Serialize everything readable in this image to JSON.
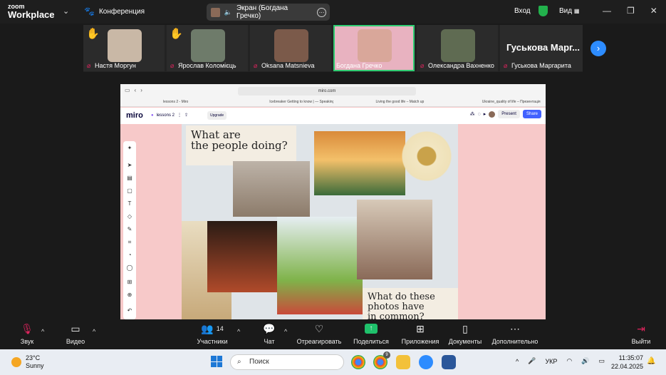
{
  "titlebar": {
    "logo_line1": "zoom",
    "logo_line2": "Workplace",
    "conference": "Конференция",
    "screen_label": "Экран (Богдана Гречко)",
    "login": "Вход",
    "view": "Вид"
  },
  "participants": [
    {
      "name": "Настя Моргун",
      "hand": true,
      "photo_color": "#c9b8a6"
    },
    {
      "name": "Ярослав Коломієць",
      "hand": true,
      "photo_color": "#6e7b6a"
    },
    {
      "name": "Oksana Matsnieva",
      "hand": false,
      "photo_color": "#7b5a4a"
    },
    {
      "name": "Богдана Гречко",
      "hand": false,
      "photo_color": "#d9a79a",
      "active": true
    },
    {
      "name": "Олександра Вахненко",
      "hand": false,
      "photo_color": "#5f6b52"
    },
    {
      "name": "Гуськова Маргарита",
      "hand": false,
      "big_label": "Гуськова  Марг..."
    }
  ],
  "browser": {
    "url": "miro.com",
    "tabs": [
      "lessons 2 - Miro",
      "Icebreaker Getting to know | — Speaking cards",
      "Living the good life – Match up",
      "Ukraine_quality of life – Презентація"
    ]
  },
  "miro": {
    "brand": "miro",
    "board_name": "lessons 2",
    "upgrade": "Upgrade",
    "present": "Present",
    "share": "Share"
  },
  "collage": {
    "title1_line1": "What are",
    "title1_line2": "the people doing?",
    "title2_line1": "What do these",
    "title2_line2": "photos have",
    "title2_line3": "in common?"
  },
  "bottombar": {
    "audio": "Звук",
    "video": "Видео",
    "participants": "Участники",
    "participants_count": "14",
    "chat": "Чат",
    "react": "Отреагировать",
    "share": "Поделиться",
    "apps": "Приложения",
    "docs": "Документы",
    "more": "Дополнительно",
    "leave": "Выйти"
  },
  "taskbar": {
    "temperature": "23°C",
    "weather": "Sunny",
    "search_placeholder": "Поиск",
    "chrome_badge": "9",
    "language": "УКР",
    "time": "11:35:07",
    "date": "22.04.2025"
  },
  "colors": {
    "zoom_blue": "#2d8cff",
    "active_green": "#2ecc71",
    "muted_red": "#e0245e",
    "share_green": "#1fc16b",
    "miro_blue": "#4262ff"
  }
}
